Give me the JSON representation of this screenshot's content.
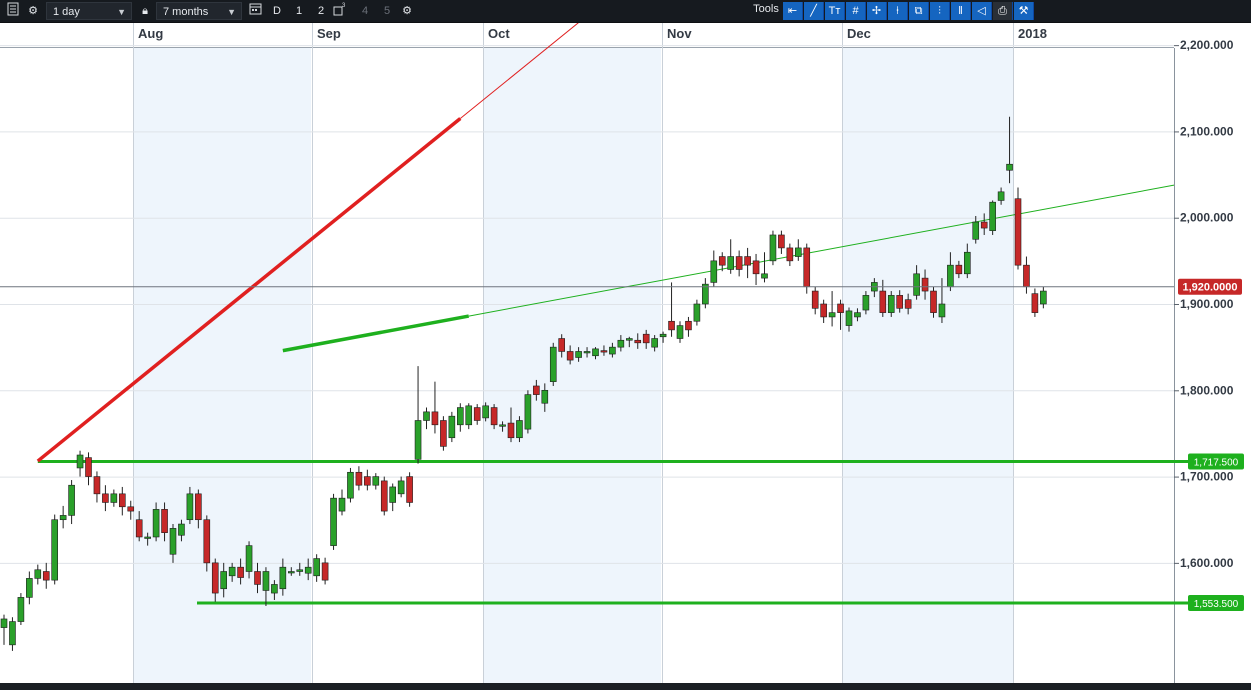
{
  "toolbar": {
    "interval": "1 day",
    "range": "7 months",
    "chart_type_labels": [
      "D",
      "1",
      "2",
      "4",
      "5"
    ],
    "tools_label": "Tools",
    "icons": [
      "menu-icon",
      "settings-icon",
      "lock-icon",
      "calendar-icon",
      "layout-icon",
      "gear-icon",
      "back-arrow-icon",
      "trendline-icon",
      "text-icon",
      "grid-icon",
      "crosshair-icon",
      "candle-icon",
      "copy-icon",
      "fib-icon",
      "bars-icon",
      "label-icon",
      "print-icon",
      "magnet-icon"
    ]
  },
  "chart_data": {
    "type": "candlestick",
    "x_tick_labels": [
      "Aug",
      "Sep",
      "Oct",
      "Nov",
      "Dec",
      "2018"
    ],
    "y_tick_labels": [
      "2,200.000",
      "2,100.000",
      "2,000.000",
      "1,900.000",
      "1,800.000",
      "1,700.000",
      "1,600.000"
    ],
    "y_ticks": [
      2200,
      2100,
      2000,
      1900,
      1800,
      1700,
      1600
    ],
    "ylim": [
      1491,
      2244
    ],
    "price_marker": {
      "label": "1,920.0000",
      "value": 1920,
      "color": "#c62828"
    },
    "horizontal_levels": [
      {
        "label": "1,717.500",
        "value": 1717.5,
        "color": "#1eb01e"
      },
      {
        "label": "1,553.500",
        "value": 1553.5,
        "color": "#1eb01e"
      }
    ],
    "trendlines": [
      {
        "color": "#e02020",
        "x1": 4,
        "y1": 1718,
        "x2": 54,
        "y2": 2115,
        "extended": true
      },
      {
        "color": "#1eb01e",
        "x1": 33,
        "y1": 1846,
        "x2": 55,
        "y2": 1886,
        "extended": true
      }
    ],
    "up_color": "#2aa02a",
    "down_color": "#c62828",
    "candles": [
      [
        1525,
        1535,
        1505,
        1540
      ],
      [
        1505,
        1532,
        1498,
        1537
      ],
      [
        1532,
        1560,
        1528,
        1565
      ],
      [
        1560,
        1582,
        1552,
        1590
      ],
      [
        1582,
        1592,
        1575,
        1598
      ],
      [
        1590,
        1580,
        1570,
        1600
      ],
      [
        1580,
        1650,
        1575,
        1656
      ],
      [
        1650,
        1655,
        1640,
        1666
      ],
      [
        1655,
        1690,
        1645,
        1696
      ],
      [
        1710,
        1725,
        1700,
        1730
      ],
      [
        1722,
        1700,
        1690,
        1728
      ],
      [
        1700,
        1680,
        1670,
        1706
      ],
      [
        1680,
        1670,
        1660,
        1690
      ],
      [
        1670,
        1680,
        1665,
        1685
      ],
      [
        1680,
        1665,
        1655,
        1688
      ],
      [
        1665,
        1660,
        1650,
        1672
      ],
      [
        1650,
        1630,
        1625,
        1660
      ],
      [
        1630,
        1630,
        1620,
        1635
      ],
      [
        1630,
        1662,
        1625,
        1670
      ],
      [
        1662,
        1635,
        1625,
        1670
      ],
      [
        1610,
        1640,
        1600,
        1645
      ],
      [
        1632,
        1645,
        1625,
        1650
      ],
      [
        1650,
        1680,
        1645,
        1688
      ],
      [
        1680,
        1650,
        1640,
        1685
      ],
      [
        1650,
        1600,
        1590,
        1655
      ],
      [
        1600,
        1565,
        1555,
        1605
      ],
      [
        1570,
        1590,
        1560,
        1600
      ],
      [
        1585,
        1595,
        1578,
        1600
      ],
      [
        1595,
        1583,
        1575,
        1605
      ],
      [
        1590,
        1620,
        1582,
        1625
      ],
      [
        1590,
        1575,
        1565,
        1600
      ],
      [
        1568,
        1590,
        1550,
        1595
      ],
      [
        1565,
        1575,
        1557,
        1580
      ],
      [
        1570,
        1595,
        1562,
        1605
      ],
      [
        1590,
        1590,
        1585,
        1595
      ],
      [
        1590,
        1592,
        1585,
        1600
      ],
      [
        1588,
        1595,
        1580,
        1605
      ],
      [
        1585,
        1605,
        1578,
        1610
      ],
      [
        1600,
        1580,
        1575,
        1606
      ],
      [
        1620,
        1675,
        1615,
        1680
      ],
      [
        1660,
        1675,
        1655,
        1685
      ],
      [
        1675,
        1705,
        1670,
        1710
      ],
      [
        1705,
        1690,
        1684,
        1712
      ],
      [
        1700,
        1690,
        1684,
        1708
      ],
      [
        1690,
        1700,
        1685,
        1704
      ],
      [
        1695,
        1660,
        1655,
        1700
      ],
      [
        1670,
        1688,
        1660,
        1692
      ],
      [
        1680,
        1695,
        1676,
        1700
      ],
      [
        1700,
        1670,
        1665,
        1705
      ],
      [
        1720,
        1765,
        1715,
        1828
      ],
      [
        1765,
        1775,
        1755,
        1780
      ],
      [
        1775,
        1760,
        1750,
        1810
      ],
      [
        1765,
        1735,
        1730,
        1770
      ],
      [
        1745,
        1770,
        1740,
        1775
      ],
      [
        1760,
        1780,
        1752,
        1785
      ],
      [
        1760,
        1782,
        1755,
        1785
      ],
      [
        1780,
        1765,
        1760,
        1784
      ],
      [
        1768,
        1782,
        1764,
        1786
      ],
      [
        1780,
        1760,
        1755,
        1784
      ],
      [
        1760,
        1760,
        1752,
        1764
      ],
      [
        1762,
        1745,
        1740,
        1780
      ],
      [
        1745,
        1765,
        1740,
        1770
      ],
      [
        1755,
        1795,
        1750,
        1800
      ],
      [
        1805,
        1795,
        1788,
        1812
      ],
      [
        1785,
        1800,
        1775,
        1808
      ],
      [
        1810,
        1850,
        1805,
        1855
      ],
      [
        1860,
        1845,
        1838,
        1865
      ],
      [
        1845,
        1835,
        1830,
        1852
      ],
      [
        1838,
        1845,
        1833,
        1850
      ],
      [
        1845,
        1845,
        1838,
        1850
      ],
      [
        1840,
        1848,
        1836,
        1850
      ],
      [
        1846,
        1845,
        1840,
        1852
      ],
      [
        1842,
        1850,
        1838,
        1855
      ],
      [
        1850,
        1858,
        1845,
        1864
      ],
      [
        1858,
        1860,
        1850,
        1862
      ],
      [
        1858,
        1855,
        1848,
        1866
      ],
      [
        1865,
        1855,
        1848,
        1870
      ],
      [
        1850,
        1860,
        1845,
        1864
      ],
      [
        1862,
        1865,
        1855,
        1868
      ],
      [
        1880,
        1870,
        1862,
        1925
      ],
      [
        1860,
        1875,
        1855,
        1880
      ],
      [
        1880,
        1870,
        1862,
        1885
      ],
      [
        1880,
        1900,
        1875,
        1905
      ],
      [
        1900,
        1923,
        1895,
        1930
      ],
      [
        1925,
        1950,
        1920,
        1962
      ],
      [
        1955,
        1945,
        1938,
        1960
      ],
      [
        1940,
        1955,
        1935,
        1975
      ],
      [
        1955,
        1940,
        1932,
        1962
      ],
      [
        1955,
        1945,
        1930,
        1965
      ],
      [
        1950,
        1935,
        1922,
        1958
      ],
      [
        1930,
        1935,
        1925,
        1960
      ],
      [
        1950,
        1980,
        1945,
        1985
      ],
      [
        1980,
        1965,
        1958,
        1985
      ],
      [
        1965,
        1950,
        1944,
        1970
      ],
      [
        1955,
        1965,
        1950,
        1975
      ],
      [
        1965,
        1920,
        1912,
        1970
      ],
      [
        1915,
        1895,
        1888,
        1920
      ],
      [
        1900,
        1885,
        1878,
        1905
      ],
      [
        1885,
        1890,
        1874,
        1915
      ],
      [
        1900,
        1890,
        1870,
        1905
      ],
      [
        1875,
        1892,
        1868,
        1896
      ],
      [
        1885,
        1890,
        1880,
        1895
      ],
      [
        1893,
        1910,
        1888,
        1915
      ],
      [
        1915,
        1925,
        1908,
        1930
      ],
      [
        1915,
        1890,
        1885,
        1928
      ],
      [
        1890,
        1910,
        1885,
        1915
      ],
      [
        1910,
        1895,
        1890,
        1916
      ],
      [
        1905,
        1895,
        1888,
        1912
      ],
      [
        1910,
        1935,
        1905,
        1945
      ],
      [
        1930,
        1915,
        1905,
        1940
      ],
      [
        1915,
        1890,
        1884,
        1920
      ],
      [
        1885,
        1900,
        1878,
        1930
      ],
      [
        1920,
        1945,
        1915,
        1960
      ],
      [
        1945,
        1935,
        1930,
        1950
      ],
      [
        1935,
        1960,
        1930,
        1970
      ],
      [
        1975,
        1995,
        1970,
        2002
      ],
      [
        1995,
        1988,
        1980,
        2005
      ],
      [
        1985,
        2018,
        1980,
        2020
      ],
      [
        2020,
        2030,
        2015,
        2035
      ],
      [
        2055,
        2062,
        2040,
        2117
      ],
      [
        2022,
        1945,
        1940,
        2035
      ],
      [
        1945,
        1920,
        1912,
        1955
      ],
      [
        1912,
        1890,
        1885,
        1918
      ],
      [
        1900,
        1915,
        1895,
        1920
      ]
    ]
  }
}
